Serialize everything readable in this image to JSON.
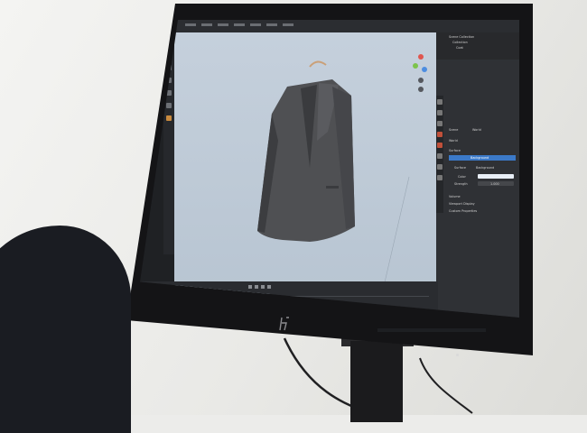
{
  "scene": {
    "description_free": true
  },
  "blender_ui": {
    "topbar": {
      "tabs": [
        "",
        "",
        "",
        "",
        ""
      ],
      "scene_label": "Scene"
    },
    "outliner": {
      "items": [
        "Scene Collection",
        "Collection",
        "Coat"
      ]
    },
    "properties": {
      "tab_scene": "Scene",
      "tab_world": "World",
      "world_name": "World",
      "section_surface": "Surface",
      "surface_shader": "Background",
      "surface_label": "Surface",
      "surface_value": "Background",
      "color_label": "Color",
      "strength_label": "Strength",
      "strength_value": "1.000",
      "section_volume": "Volume",
      "section_viewport_display": "Viewport Display",
      "section_custom_props": "Custom Properties"
    },
    "status_bar": "",
    "accent_color": "#3b79c8"
  },
  "colors": {
    "viewport_bg": "#c5d0dc",
    "jacket": "#4f5053",
    "hanger": "#caa078",
    "monitor_bezel": "#141416"
  }
}
